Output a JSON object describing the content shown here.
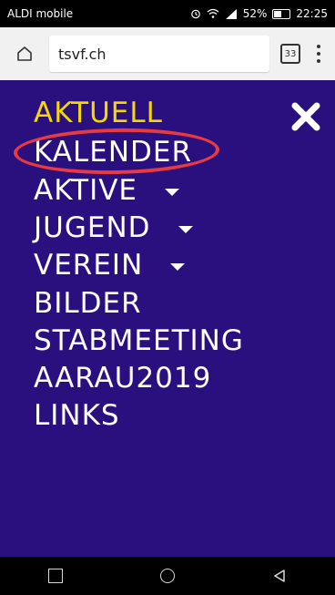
{
  "status": {
    "carrier": "ALDI mobile",
    "battery": "52%",
    "battery_level": 0.52,
    "time": "22:25"
  },
  "browser": {
    "url": "tsvf.ch",
    "tab_count": "33"
  },
  "menu": {
    "items": [
      {
        "label": "AKTUELL",
        "active": true
      },
      {
        "label": "KALENDER"
      },
      {
        "label": "AKTIVE",
        "has_dropdown": true
      },
      {
        "label": "JUGEND",
        "has_dropdown": true
      },
      {
        "label": "VEREIN",
        "has_dropdown": true
      },
      {
        "label": "BILDER"
      },
      {
        "label": "STABMEETING"
      },
      {
        "label": "AARAU2019"
      },
      {
        "label": "LINKS"
      }
    ]
  },
  "colors": {
    "background": "#2a0f7e",
    "active": "#f6d800",
    "highlight": "#e83a40",
    "text": "#ffffff"
  },
  "icons": {
    "close": "close-icon",
    "home": "home-icon",
    "menu": "more-vert-icon"
  }
}
